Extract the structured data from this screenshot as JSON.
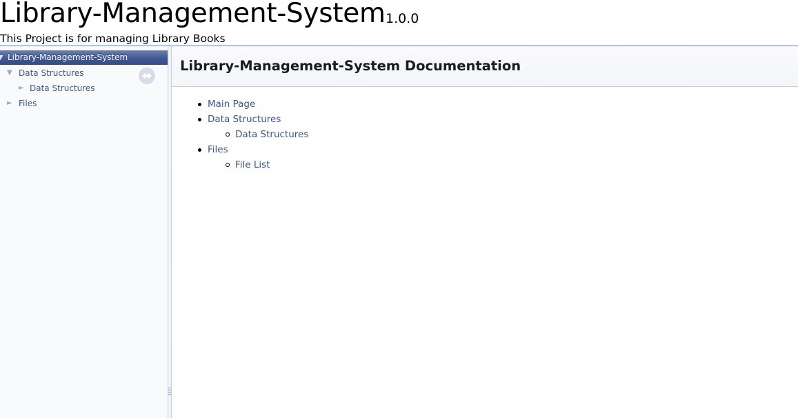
{
  "title_area": {
    "project_name": "Library-Management-System",
    "project_number": "1.0.0",
    "project_brief": "This Project is for managing Library Books"
  },
  "nav_tree": {
    "root_label": "Library-Management-System",
    "items": [
      {
        "label": "Data Structures",
        "arrow": "▼"
      },
      {
        "label": "Data Structures",
        "arrow": "►"
      },
      {
        "label": "Files",
        "arrow": "►"
      }
    ],
    "root_arrow": "▼",
    "sync_icon": "sync-arrows-icon"
  },
  "main": {
    "header_title": "Library-Management-System Documentation",
    "links": [
      {
        "label": "Main Page"
      },
      {
        "label": "Data Structures"
      },
      {
        "label": "Data Structures"
      },
      {
        "label": "Files"
      },
      {
        "label": "File List"
      }
    ]
  },
  "colors": {
    "link": "#3d578c",
    "selected_bg": "#3f5793",
    "title_rule": "#6b7ea9"
  }
}
